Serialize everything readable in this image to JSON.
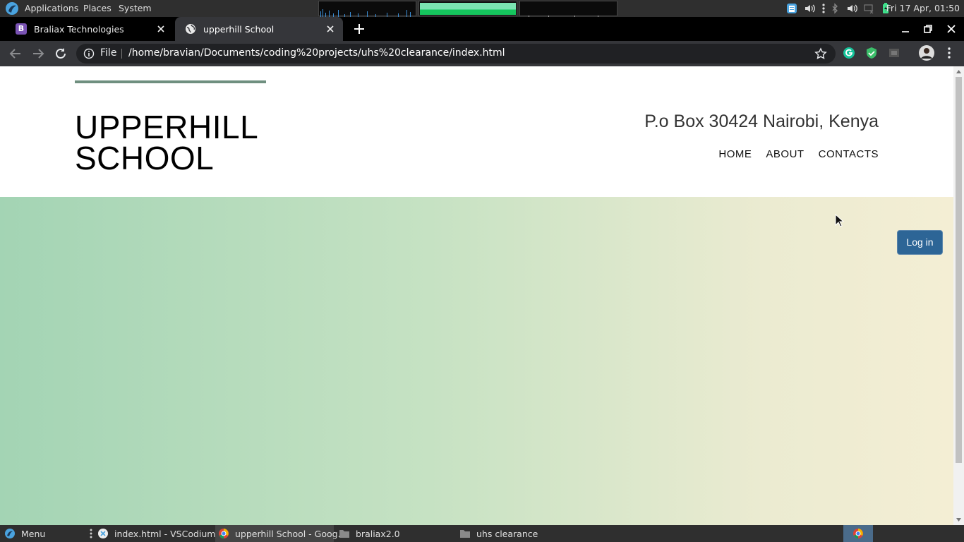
{
  "system_panel": {
    "menus": [
      "Applications",
      "Places",
      "System"
    ],
    "clock": "Fri 17 Apr, 01:50"
  },
  "browser": {
    "tabs": [
      {
        "title": "Braliax Technologies",
        "favicon": "B"
      },
      {
        "title": "upperhill School"
      }
    ],
    "omnibox": {
      "scheme_label": "File",
      "url": "/home/bravian/Documents/coding%20projects/uhs%20clearance/index.html"
    }
  },
  "page": {
    "brand": "UPPERHILL SCHOOL",
    "address": "P.o Box 30424 Nairobi, Kenya",
    "nav": [
      "HOME",
      "ABOUT",
      "CONTACTS"
    ],
    "login_label": "Log in"
  },
  "taskbar": {
    "menu_label": "Menu",
    "items": [
      {
        "label": "index.html - VSCodium"
      },
      {
        "label": "upperhill School - Goog..."
      },
      {
        "label": "braliax2.0"
      },
      {
        "label": "uhs clearance"
      }
    ]
  },
  "colors": {
    "hero_start": "#a3d4b4",
    "hero_end": "#f4eed4",
    "login_button": "#2d6596",
    "brand_bar": "#6f8f7f"
  }
}
